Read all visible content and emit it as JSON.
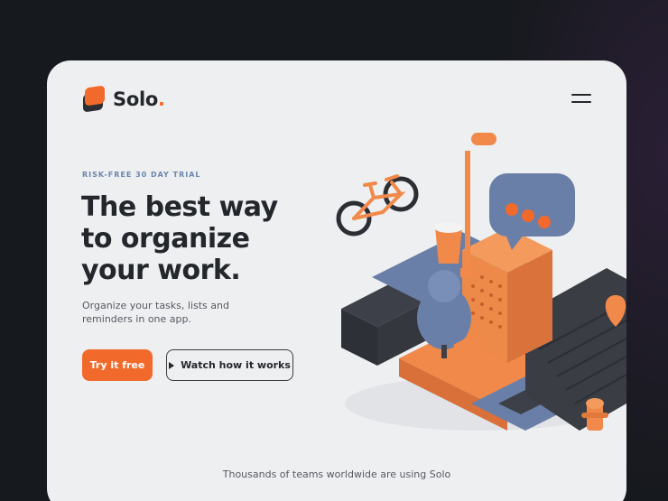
{
  "brand": {
    "name": "Solo",
    "dot": "."
  },
  "hero": {
    "eyebrow": "RISK-FREE 30 DAY TRIAL",
    "headline": "The best way to organize your work.",
    "subtext": "Organize your tasks, lists and reminders in one app.",
    "primary_cta": "Try it free",
    "secondary_cta": "Watch how it works"
  },
  "footer": {
    "social_proof": "Thousands of teams worldwide are using Solo"
  },
  "icons": {
    "logo": "solo-logo-icon",
    "menu": "hamburger-menu-icon",
    "play": "play-icon"
  },
  "colors": {
    "accent": "#f26a2b",
    "dark": "#23262b",
    "eyebrow": "#6b86ad",
    "card_bg": "#eeeff1",
    "page_bg": "#16191d"
  }
}
